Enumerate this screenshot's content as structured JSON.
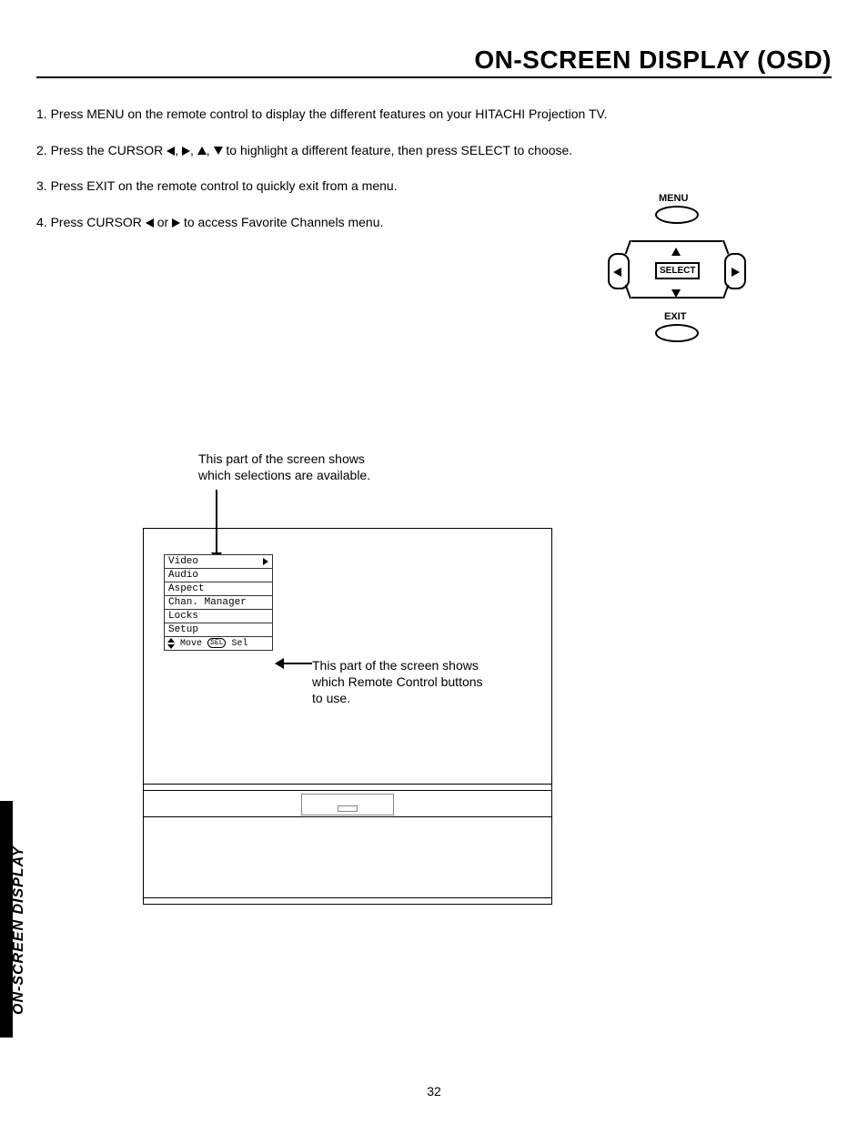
{
  "page_title": "ON-SCREEN DISPLAY (OSD)",
  "instructions": {
    "i1_pre": "1.  Press MENU on the remote control to display the different features on your HITACHI Projection TV.",
    "i2_pre": "2.  Press the CURSOR ",
    "i2_post": "  to highlight a different feature, then press SELECT to choose.",
    "i3": "3.  Press EXIT on the remote control to quickly exit from a menu.",
    "i4_pre": "4.  Press CURSOR ",
    "i4_mid": " or ",
    "i4_post": " to access Favorite Channels menu."
  },
  "remote": {
    "menu": "MENU",
    "select": "SELECT",
    "exit": "EXIT"
  },
  "callouts": {
    "top_l1": "This part of the screen shows",
    "top_l2": "which selections are available.",
    "right_l1": "This part of the screen shows",
    "right_l2": "which Remote Control buttons",
    "right_l3": "to use."
  },
  "menu": {
    "items": [
      "Video",
      "Audio",
      "Aspect",
      "Chan. Manager",
      "Locks",
      "Setup"
    ],
    "hint_move": "Move",
    "hint_sel_oval": "SEL",
    "hint_sel": "Sel"
  },
  "side_tab": "ON-SCREEN DISPLAY",
  "page_number": "32"
}
